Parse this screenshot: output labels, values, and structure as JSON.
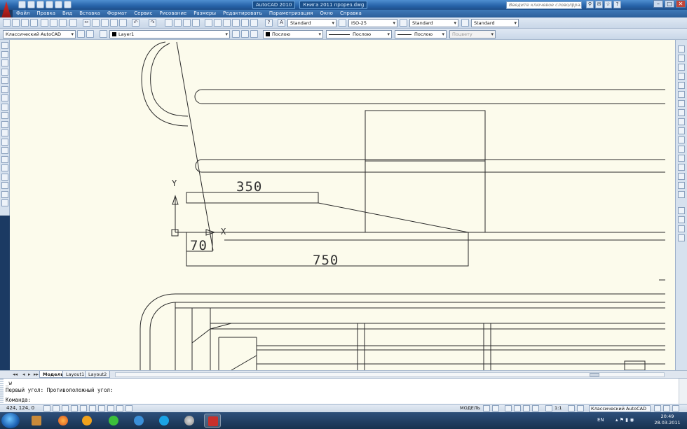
{
  "window": {
    "title": "AutoCAD 2010",
    "document": "Книга 2011 прорез.dwg",
    "search_placeholder": "Введите ключевое слово/фразу"
  },
  "menu": [
    "Файл",
    "Правка",
    "Вид",
    "Вставка",
    "Формат",
    "Сервис",
    "Рисование",
    "Размеры",
    "Редактировать",
    "Параметризация",
    "Окно",
    "Справка"
  ],
  "toolbar": {
    "text_style": "Standard",
    "dim_style": "ISO-25",
    "table_style": "Standard",
    "mleader_style": "Standard",
    "workspace": "Классический AutoCAD",
    "layer": "Layer1",
    "color": "Послою",
    "linetype": "Послою",
    "lineweight": "Послою",
    "plotstyle": "Поцвету"
  },
  "drawing": {
    "ucs_y": "Y",
    "ucs_x": "X",
    "dimensions": [
      "350",
      "70",
      "750"
    ]
  },
  "tabs": [
    "Модель",
    "Layout1",
    "Layout2"
  ],
  "command": {
    "history1": "_w",
    "history2": "Первый угол: Противоположный угол:",
    "prompt": "Команда:"
  },
  "status": {
    "coords": "424, 124, 0",
    "model": "МОДЕЛЬ",
    "scale": "1:1",
    "workspace": "Классический AutoCAD"
  },
  "taskbar": {
    "lang": "EN",
    "time": "20:49",
    "date": "28.03.2011"
  },
  "colors": {
    "canvas": "#fcfbec",
    "titlebar": "#2763a9",
    "taskbar": "#18324f"
  }
}
